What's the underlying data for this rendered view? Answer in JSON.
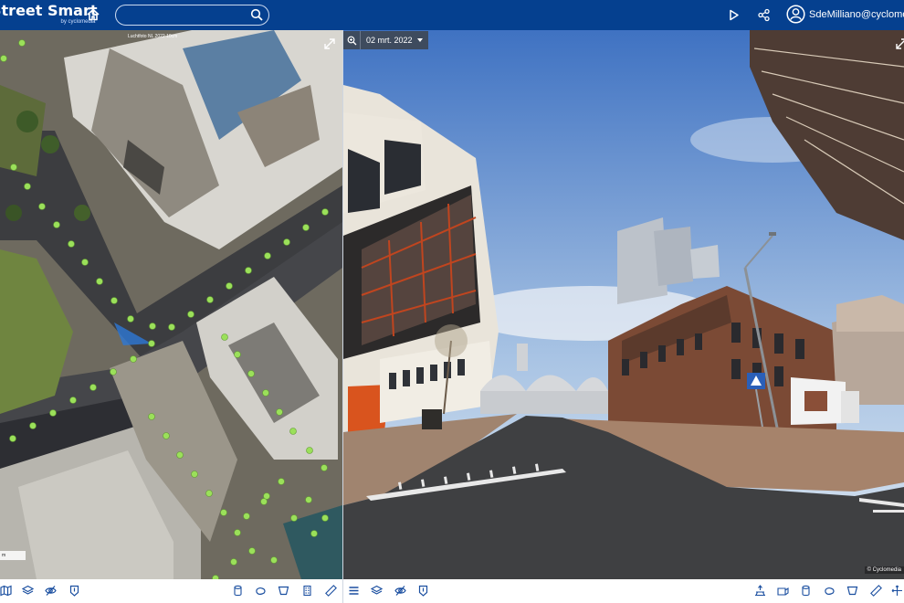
{
  "app": {
    "title": "Street Smart",
    "subtitle": "by cyclomedia"
  },
  "header": {
    "search_value": "",
    "user_email": "SdeMilliano@cyclomedia.com"
  },
  "map": {
    "credit": "Luchtfoto NL 2022 10cm",
    "scale_label": "m"
  },
  "streetview": {
    "date_label": "02 mrt. 2022",
    "credit": "© Cyclomedia"
  },
  "colors": {
    "header_bg": "#05408f",
    "accent": "#1b4fa0",
    "recording_dot": "#9be05a"
  },
  "icons": {
    "header": [
      "home-icon",
      "search-icon",
      "play-icon",
      "share-icon",
      "user-icon"
    ],
    "map_toolbar": [
      "map-icon",
      "layers-icon",
      "visibility-off-icon",
      "marker-icon",
      "cylinder-icon",
      "area-icon",
      "trapezoid-icon",
      "building-icon",
      "ruler-icon"
    ],
    "street_toolbar": [
      "menu-icon",
      "layers-icon",
      "visibility-off-icon",
      "marker-icon",
      "elevation-icon",
      "window-icon",
      "cylinder-icon",
      "area-icon",
      "trapezoid-icon",
      "ruler-icon",
      "move-icon"
    ]
  }
}
